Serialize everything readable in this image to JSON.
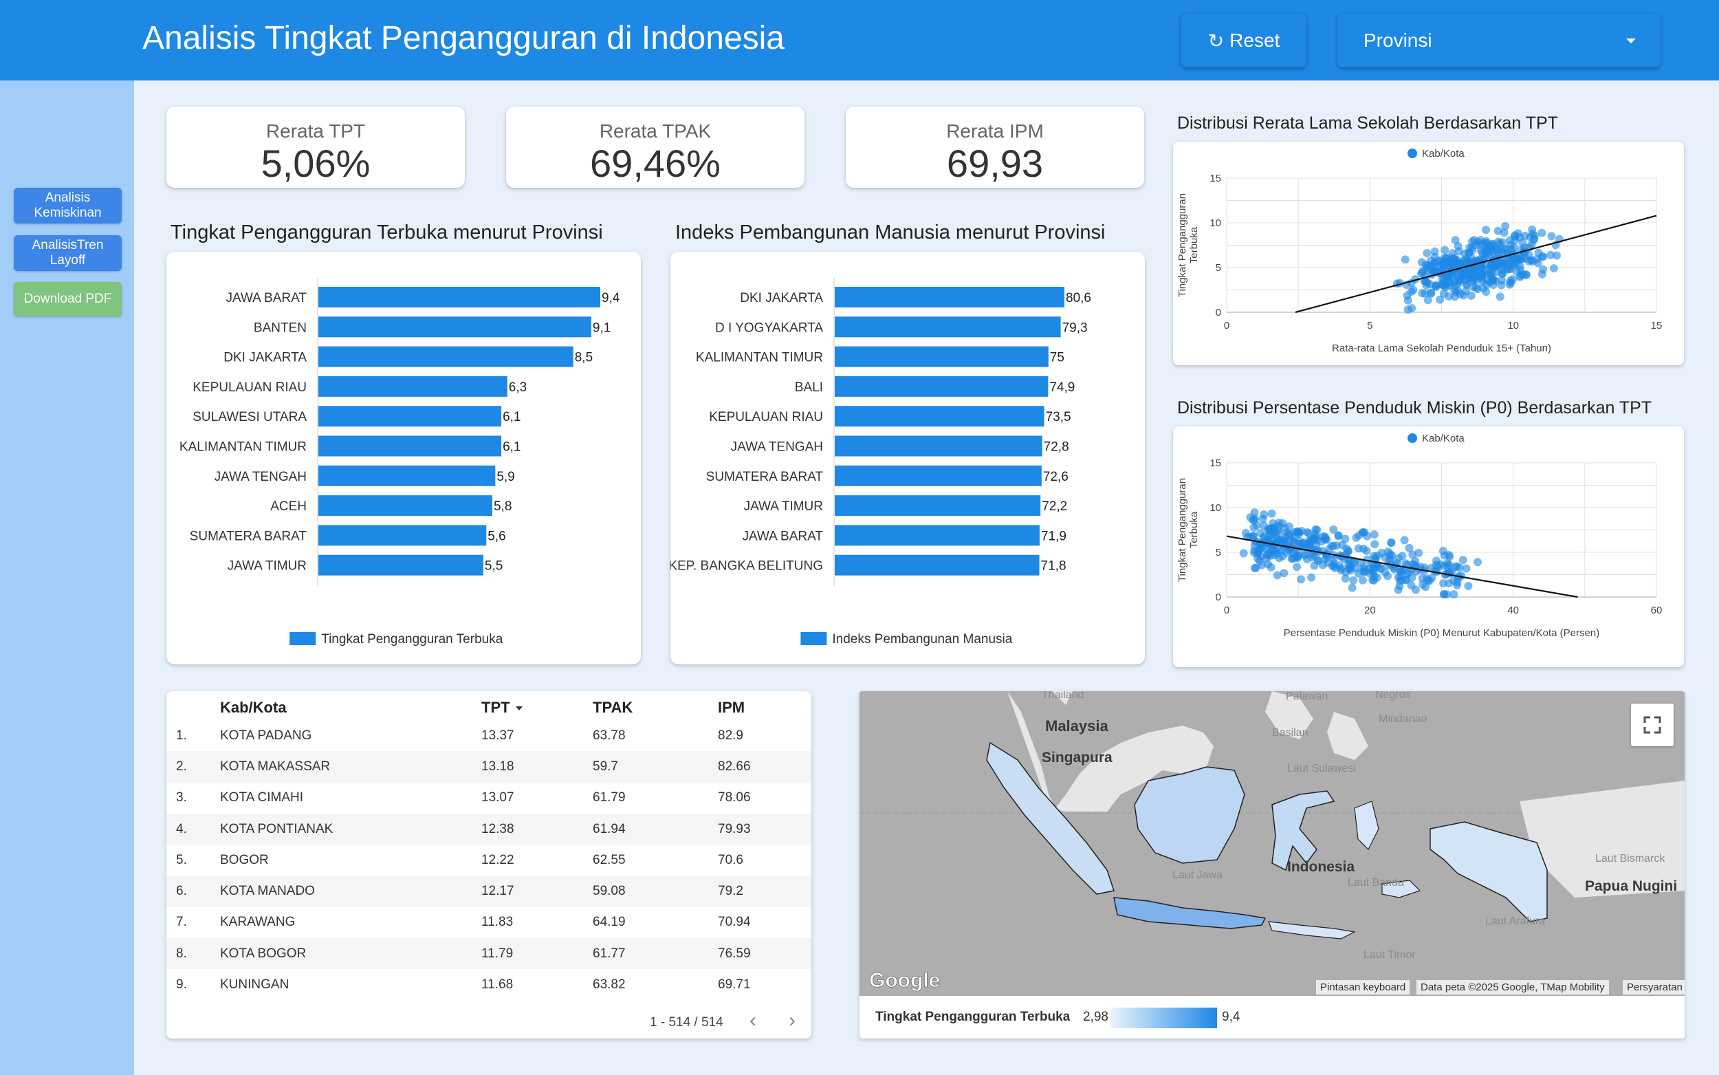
{
  "header": {
    "title": "Analisis Tingkat Pengangguran di Indonesia",
    "reset_label": "Reset",
    "province_select": "Provinsi",
    "colors": {
      "primary": "#1e88e5"
    }
  },
  "sidebar": {
    "buttons": [
      "Analisis Kemiskinan",
      "AnalisisTren Layoff",
      "Download PDF"
    ]
  },
  "kpis": [
    {
      "label": "Rerata TPT",
      "value": "5,06%"
    },
    {
      "label": "Rerata TPAK",
      "value": "69,46%"
    },
    {
      "label": "Rerata IPM",
      "value": "69,93"
    }
  ],
  "chart_data": [
    {
      "type": "bar",
      "orientation": "horizontal",
      "title": "Tingkat Pengangguran Terbuka menurut Provinsi",
      "categories": [
        "JAWA BARAT",
        "BANTEN",
        "DKI JAKARTA",
        "KEPULAUAN RIAU",
        "SULAWESI UTARA",
        "KALIMANTAN TIMUR",
        "JAWA TENGAH",
        "ACEH",
        "SUMATERA BARAT",
        "JAWA TIMUR"
      ],
      "values": [
        9.4,
        9.1,
        8.5,
        6.3,
        6.1,
        6.1,
        5.9,
        5.8,
        5.6,
        5.5
      ],
      "labels": [
        "9,4",
        "9,1",
        "8,5",
        "6,3",
        "6,1",
        "6,1",
        "5,9",
        "5,8",
        "5,6",
        "5,5"
      ],
      "series": [
        {
          "name": "Tingkat Pengangguran Terbuka"
        }
      ],
      "legend": "bottom",
      "color": "#1e88e5"
    },
    {
      "type": "bar",
      "orientation": "horizontal",
      "title": "Indeks Pembangunan Manusia menurut Provinsi",
      "categories": [
        "DKI JAKARTA",
        "D I YOGYAKARTA",
        "KALIMANTAN TIMUR",
        "BALI",
        "KEPULAUAN RIAU",
        "JAWA TENGAH",
        "SUMATERA BARAT",
        "JAWA TIMUR",
        "JAWA BARAT",
        "KEP. BANGKA BELITUNG"
      ],
      "values": [
        80.6,
        79.3,
        75,
        74.9,
        73.5,
        72.8,
        72.6,
        72.2,
        71.9,
        71.8
      ],
      "labels": [
        "80,6",
        "79,3",
        "75",
        "74,9",
        "73,5",
        "72,8",
        "72,6",
        "72,2",
        "71,9",
        "71,8"
      ],
      "series": [
        {
          "name": "Indeks Pembangunan Manusia"
        }
      ],
      "legend": "bottom",
      "color": "#1e88e5"
    },
    {
      "type": "scatter",
      "title": "Distribusi Rerata Lama Sekolah Berdasarkan TPT",
      "xlabel": "Rata-rata Lama Sekolah Penduduk 15+ (Tahun)",
      "ylabel": "Tingkat Pengangguran Terbuka",
      "xlim": [
        0,
        15
      ],
      "ylim": [
        0,
        15
      ],
      "xticks": [
        "0",
        "5",
        "10",
        "15"
      ],
      "yticks": [
        "0",
        "5",
        "10",
        "15"
      ],
      "series": [
        {
          "name": "Kab/Kota"
        }
      ],
      "trendline": {
        "x": [
          2.4,
          15
        ],
        "y": [
          0,
          10.8
        ]
      },
      "grid": true,
      "legend": "top"
    },
    {
      "type": "scatter",
      "title": "Distribusi Persentase Penduduk Miskin (P0) Berdasarkan TPT",
      "xlabel": "Persentase Penduduk Miskin (P0) Menurut Kabupaten/Kota (Persen)",
      "ylabel": "Tingkat Pengangguran Terbuka",
      "xlim": [
        0,
        60
      ],
      "ylim": [
        0,
        15
      ],
      "xticks": [
        "0",
        "20",
        "40",
        "60"
      ],
      "yticks": [
        "0",
        "5",
        "10",
        "15"
      ],
      "series": [
        {
          "name": "Kab/Kota"
        }
      ],
      "trendline": {
        "x": [
          0,
          49
        ],
        "y": [
          6.8,
          0
        ]
      },
      "grid": true,
      "legend": "top"
    }
  ],
  "table": {
    "columns": [
      "Kab/Kota",
      "TPT",
      "TPAK",
      "IPM"
    ],
    "rows": [
      {
        "no": "1.",
        "name": "KOTA PADANG",
        "tpt": "13.37",
        "tpak": "63.78",
        "ipm": "82.9"
      },
      {
        "no": "2.",
        "name": "KOTA MAKASSAR",
        "tpt": "13.18",
        "tpak": "59.7",
        "ipm": "82.66"
      },
      {
        "no": "3.",
        "name": "KOTA CIMAHI",
        "tpt": "13.07",
        "tpak": "61.79",
        "ipm": "78.06"
      },
      {
        "no": "4.",
        "name": "KOTA PONTIANAK",
        "tpt": "12.38",
        "tpak": "61.94",
        "ipm": "79.93"
      },
      {
        "no": "5.",
        "name": "BOGOR",
        "tpt": "12.22",
        "tpak": "62.55",
        "ipm": "70.6"
      },
      {
        "no": "6.",
        "name": "KOTA MANADO",
        "tpt": "12.17",
        "tpak": "59.08",
        "ipm": "79.2"
      },
      {
        "no": "7.",
        "name": "KARAWANG",
        "tpt": "11.83",
        "tpak": "64.19",
        "ipm": "70.94"
      },
      {
        "no": "8.",
        "name": "KOTA BOGOR",
        "tpt": "11.79",
        "tpak": "61.77",
        "ipm": "76.59"
      },
      {
        "no": "9.",
        "name": "KUNINGAN",
        "tpt": "11.68",
        "tpak": "63.82",
        "ipm": "69.71"
      }
    ],
    "pagination": "1 - 514 / 514"
  },
  "map": {
    "labels": [
      "Malaysia",
      "Singapura",
      "Indonesia",
      "Papua Nugini",
      "Laut Jawa",
      "Laut Banda",
      "Laut Sulawesi",
      "Laut Arafura",
      "Laut Timor",
      "Laut Bismarck",
      "Palawan",
      "Negros",
      "Mindanao",
      "Basilan",
      "Thailand"
    ],
    "google_logo": "Google",
    "attribution": [
      "Pintasan keyboard",
      "Data peta ©2025 Google, TMap Mobility",
      "Persyaratan"
    ],
    "legend": {
      "title": "Tingkat Pengangguran Terbuka",
      "min": "2,98",
      "max": "9,4"
    }
  }
}
